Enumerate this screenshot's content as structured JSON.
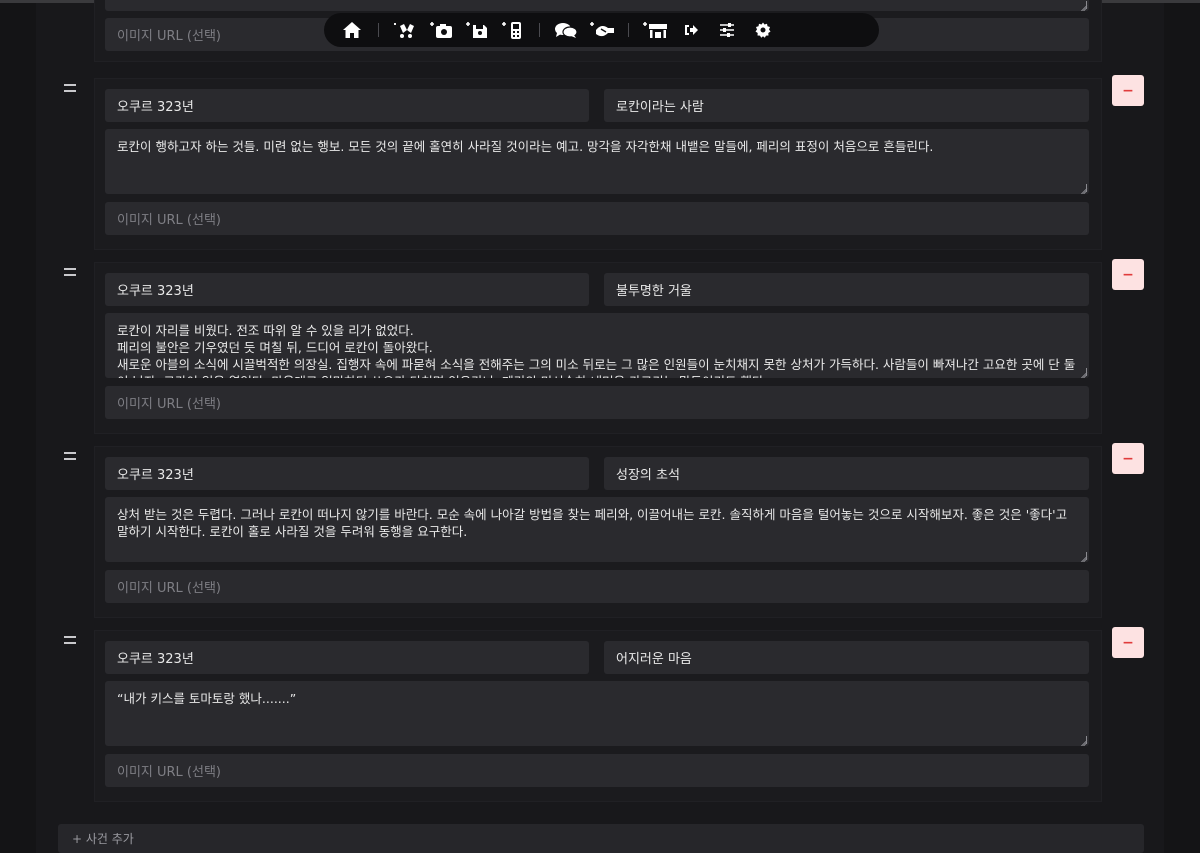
{
  "toolbar": {
    "icons": [
      "home-icon",
      "add-relationship-icon",
      "add-photo-icon",
      "add-save-icon",
      "add-device-icon",
      "chat-icon",
      "add-handshake-icon",
      "add-store-icon",
      "logout-icon",
      "sliders-icon",
      "gear-icon"
    ]
  },
  "top_partial": {
    "image_placeholder": "이미지 URL (선택)"
  },
  "events": [
    {
      "date": "오쿠르 323년",
      "title": "로칸이라는 사람",
      "description": "로칸이 행하고자 하는 것들. 미련 없는 행보. 모든 것의 끝에 홀연히 사라질 것이라는 예고. 망각을 자각한채 내뱉은 말들에, 페리의 표정이 처음으로 흔들린다.",
      "image_placeholder": "이미지 URL (선택)"
    },
    {
      "date": "오쿠르 323년",
      "title": "불투명한 거울",
      "description": "로칸이 자리를 비웠다. 전조 따위 알 수 있을 리가 없었다.\n페리의 불안은 기우였던 듯 며칠 뒤, 드디어 로칸이 돌아왔다.\n새로운 아블의 소식에 시끌벅적한 의장실. 집행자 속에 파묻혀 소식을 전해주는 그의 미소 뒤로는 그 많은 인원들이 눈치채지 못한 상처가 가득하다. 사람들이 빠져나간 고요한 곳에 단 둘이 남자, 로칸이 입을 열었다. 마음대로 일망하던 쓰으가 다쳐면 인우라나, 페리의 미서숙하 내며을 가르키는 말투이기도 했다.",
      "image_placeholder": "이미지 URL (선택)"
    },
    {
      "date": "오쿠르 323년",
      "title": "성장의 초석",
      "description": "상처 받는 것은 두렵다. 그러나 로칸이 떠나지 않기를 바란다. 모순 속에 나아갈 방법을 찾는 페리와, 이끌어내는 로칸. 솔직하게 마음을 털어놓는 것으로 시작해보자. 좋은 것은 '좋다'고 말하기 시작한다. 로칸이 홀로 사라질 것을 두려워 동행을 요구한다.",
      "image_placeholder": "이미지 URL (선택)"
    },
    {
      "date": "오쿠르 323년",
      "title": "어지러운 마음",
      "description": "“내가 키스를 토마토랑 했나.......”",
      "image_placeholder": "이미지 URL (선택)"
    }
  ],
  "remove_label": "−",
  "add_event_label": "+ 사건 추가",
  "colors": {
    "background": "#141416",
    "field": "#2a2a2e",
    "remove_bg": "#fde2e2",
    "remove_fg": "#e03c3c"
  }
}
